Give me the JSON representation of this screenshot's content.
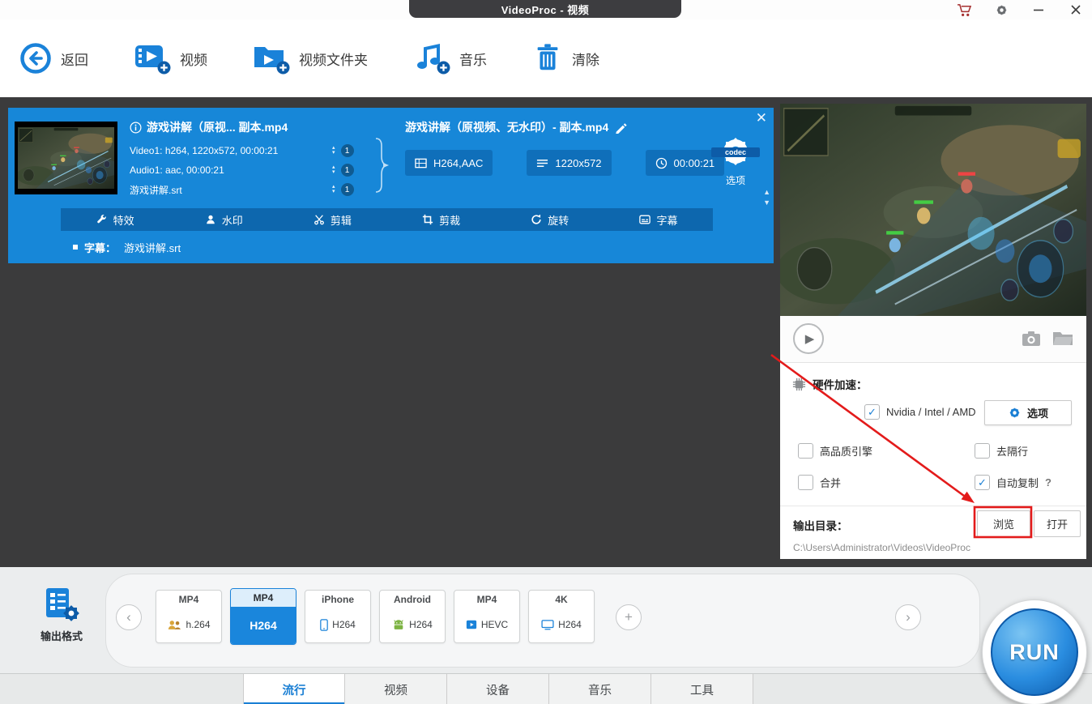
{
  "titlebar": {
    "title": "VideoProc - 视频"
  },
  "toolbar": {
    "back": "返回",
    "video": "视频",
    "video_folder": "视频文件夹",
    "music": "音乐",
    "clear": "清除"
  },
  "file_panel": {
    "source_name": "游戏讲解（原视... 副本.mp4",
    "tracks": [
      {
        "label": "Video1: h264, 1220x572, 00:00:21",
        "count": "1"
      },
      {
        "label": "Audio1: aac, 00:00:21",
        "count": "1"
      },
      {
        "label": "游戏讲解.srt",
        "count": "1"
      }
    ],
    "output_name": "游戏讲解（原视频、无水印）- 副本.mp4",
    "codec": "H264,AAC",
    "resolution": "1220x572",
    "duration": "00:00:21",
    "codec_badge": "codec",
    "codec_option": "选项",
    "edit_tabs": [
      "特效",
      "水印",
      "剪辑",
      "剪裁",
      "旋转",
      "字幕"
    ],
    "subtitle_label": "字幕：",
    "subtitle_file": "游戏讲解.srt"
  },
  "settings": {
    "hw_label": "硬件加速：",
    "hw_option": "Nvidia / Intel / AMD",
    "hw_checked": true,
    "options_button": "选项",
    "checkboxes": [
      {
        "label": "高品质引擎",
        "checked": false
      },
      {
        "label": "去隔行",
        "checked": false
      },
      {
        "label": "合并",
        "checked": false
      },
      {
        "label": "自动复制",
        "checked": true,
        "help": "?"
      }
    ],
    "output_dir_label": "输出目录：",
    "browse": "浏览",
    "open": "打开",
    "output_path": "C:\\Users\\Administrator\\Videos\\VideoProc"
  },
  "format_bar": {
    "label": "输出格式",
    "cards": [
      {
        "top": "MP4",
        "bottom": "h.264",
        "selected": false
      },
      {
        "top": "MP4",
        "bottom": "H264",
        "selected": true
      },
      {
        "top": "iPhone",
        "bottom": "H264",
        "selected": false
      },
      {
        "top": "Android",
        "bottom": "H264",
        "selected": false
      },
      {
        "top": "MP4",
        "bottom": "HEVC",
        "selected": false
      },
      {
        "top": "4K",
        "bottom": "H264",
        "selected": false
      }
    ],
    "tabs": [
      {
        "label": "流行",
        "selected": true
      },
      {
        "label": "视频",
        "selected": false
      },
      {
        "label": "设备",
        "selected": false
      },
      {
        "label": "音乐",
        "selected": false
      },
      {
        "label": "工具",
        "selected": false
      }
    ],
    "run": "RUN"
  },
  "icons": {
    "back": "arrow-left-circle",
    "video": "film-plus",
    "video_folder": "folder-play-plus",
    "music": "music-note-plus",
    "clear": "trash",
    "cart": "shopping-cart",
    "titlebar_gear": "gear",
    "minimize": "minus",
    "close": "x",
    "codec": "gear",
    "play": "play-triangle",
    "snapshot": "camera",
    "open_folder": "folder"
  },
  "colors": {
    "accent_blue": "#1a82d9",
    "panel_blue": "#1787d8",
    "panel_strip_blue": "#0d67ae",
    "annotation_red": "#e31b1b",
    "main_bg": "#3b3b3c"
  }
}
